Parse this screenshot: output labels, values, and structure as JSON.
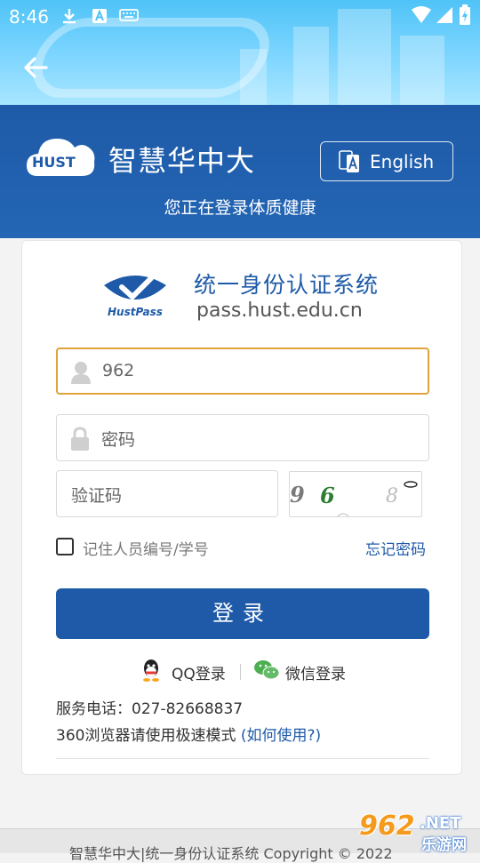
{
  "status_bar": {
    "time": "8:46"
  },
  "header": {
    "logo_badge": "HUST",
    "app_name": "智慧华中大",
    "language_button": "English",
    "subtitle": "您正在登录体质健康"
  },
  "pass": {
    "brand": "HustPass",
    "title": "统一身份认证系统",
    "url": "pass.hust.edu.cn"
  },
  "form": {
    "username_value": "962",
    "password_placeholder": "密码",
    "captcha_placeholder": "验证码",
    "captcha_text": "96 8",
    "remember_label": "记住人员编号/学号",
    "forgot_label": "忘记密码",
    "login_label": "登录"
  },
  "social": {
    "qq_label": "QQ登录",
    "wechat_label": "微信登录"
  },
  "info": {
    "phone": "服务电话：027-82668837",
    "browser_note": "360浏览器请使用极速模式",
    "browser_link": "(如何使用?)"
  },
  "footer": {
    "text": "智慧华中大|统一身份认证系统 Copyright © 2022"
  },
  "watermark": {
    "number": "962",
    "net": ".NET",
    "site": "乐游网"
  },
  "colors": {
    "primary": "#1e5aa8",
    "focus_border": "#e0a23a",
    "hero": "#4fc3f7"
  }
}
